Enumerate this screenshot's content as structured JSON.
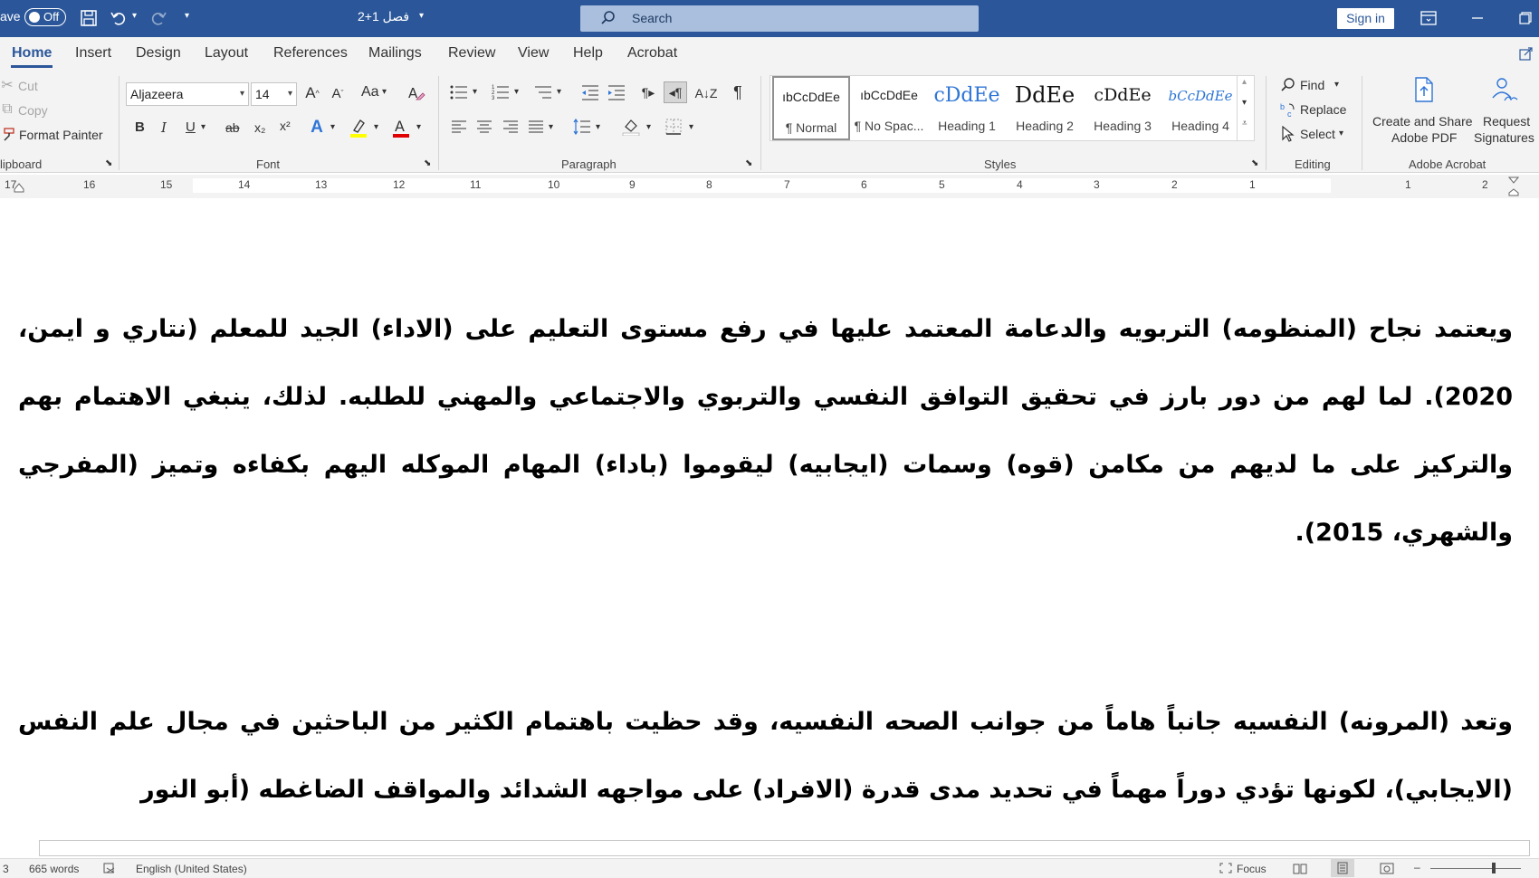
{
  "titlebar": {
    "autosave_label": "ave",
    "autosave_state": "Off",
    "document_title": "فصل 1+2",
    "search_placeholder": "Search",
    "signin_label": "Sign in"
  },
  "tabs": [
    "Home",
    "Insert",
    "Design",
    "Layout",
    "References",
    "Mailings",
    "Review",
    "View",
    "Help",
    "Acrobat"
  ],
  "active_tab": "Home",
  "ribbon": {
    "clipboard": {
      "cut": "Cut",
      "copy": "Copy",
      "format_painter": "Format Painter",
      "label": "lipboard"
    },
    "font": {
      "font_name": "Aljazeera",
      "font_size": "14",
      "change_case": "Aa",
      "bold": "B",
      "italic": "I",
      "underline": "U",
      "strike": "ab",
      "subscript": "x₂",
      "superscript": "x²",
      "label": "Font"
    },
    "paragraph": {
      "label": "Paragraph"
    },
    "styles": {
      "label": "Styles",
      "items": [
        {
          "sample": "ıbCcDdEe",
          "name": "¶ Normal"
        },
        {
          "sample": "ıbCcDdEe",
          "name": "¶ No Spac..."
        },
        {
          "sample": "cDdEe",
          "name": "Heading 1"
        },
        {
          "sample": "DdEe",
          "name": "Heading 2"
        },
        {
          "sample": "cDdEe",
          "name": "Heading 3"
        },
        {
          "sample": "bCcDdEe",
          "name": "Heading 4"
        }
      ]
    },
    "editing": {
      "find": "Find",
      "replace": "Replace",
      "select": "Select",
      "label": "Editing"
    },
    "acrobat": {
      "create_share_line1": "Create and Share",
      "create_share_line2": "Adobe PDF",
      "request_line1": "Request",
      "request_line2": "Signatures",
      "label": "Adobe Acrobat"
    }
  },
  "ruler": [
    "17",
    "16",
    "15",
    "14",
    "13",
    "12",
    "11",
    "10",
    "9",
    "8",
    "7",
    "6",
    "5",
    "4",
    "3",
    "2",
    "1",
    "1",
    "2"
  ],
  "document": {
    "paragraph_1": "ويعتمد نجاح (المنظومه) التربويه والدعامة المعتمد عليها في رفع مستوى التعليم على (الاداء) الجيد للمعلم (نتاري و ايمن، 2020). لما لهم من دور بارز في تحقيق التوافق النفسي والتربوي والاجتماعي والمهني للطلبه. لذلك، ينبغي الاهتمام بهم والتركيز على ما لديهم من مكامن (قوه) وسمات (ايجابيه) ليقوموا (باداء) المهام الموكله اليهم بكفاءه وتميز (المفرجي والشهري، 2015).",
    "paragraph_2": "وتعد (المرونه) النفسيه جانباً هاماً من جوانب الصحه النفسيه، وقد حظيت باهتمام الكثير من الباحثين في مجال علم النفس (الايجابي)، لكونها تؤدي دوراً مهماً في تحديد مدى قدرة (الافراد) على مواجهه الشدائد والمواقف الضاغطه (أبو النور"
  },
  "statusbar": {
    "page": "3",
    "words": "665 words",
    "language": "English (United States)",
    "focus": "Focus"
  },
  "colors": {
    "titlebar": "#2b579a",
    "ribbon_bg": "#f3f3f3",
    "accent": "#2b579a"
  }
}
